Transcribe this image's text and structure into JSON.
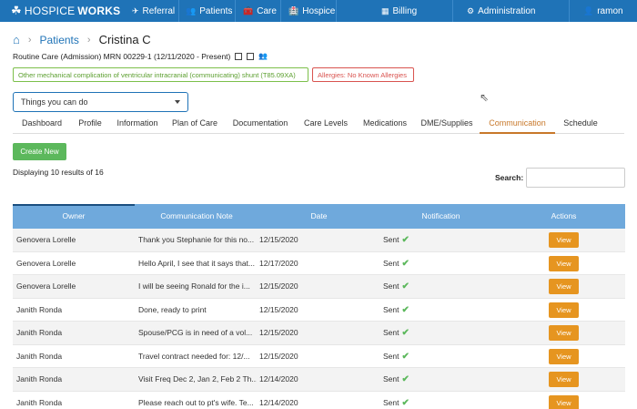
{
  "nav": {
    "brand_prefix": "HOSPICE",
    "brand_bold": "WORKS",
    "items": [
      {
        "label": "Referral",
        "icon": "✈"
      },
      {
        "label": "Patients",
        "icon": "👥"
      },
      {
        "label": "Care",
        "icon": "🧰"
      },
      {
        "label": "Hospice",
        "icon": "🏥"
      },
      {
        "label": "Billing",
        "icon": "▦"
      },
      {
        "label": "Administration",
        "icon": "⚙"
      },
      {
        "label": "ramon",
        "icon": "👤"
      }
    ]
  },
  "breadcrumb": {
    "home_icon": "⌂",
    "patients": "Patients",
    "current": "Cristina C"
  },
  "patient": {
    "care_line": "Routine Care (Admission) MRN 00229-1 (12/11/2020 - Present)",
    "diagnosis_tag": "Other mechanical complication of ventricular intracranial (communicating) shunt (T85.09XA)",
    "allergy_tag": "Allergies: No Known Allergies"
  },
  "actions_select": {
    "value": "Things you can do"
  },
  "tabs": [
    "Dashboard",
    "Profile",
    "Information",
    "Plan of Care",
    "Documentation",
    "Care Levels",
    "Medications",
    "DME/Supplies",
    "Communication",
    "Schedule"
  ],
  "active_tab": "Communication",
  "create_button": "Create New",
  "displaying": "Displaying 10 results of 16",
  "search_label": "Search:",
  "table": {
    "headers": [
      "Owner",
      "Communication Note",
      "Date",
      "Notification",
      "Actions"
    ],
    "rows": [
      {
        "owner": "Genovera Lorelle",
        "note": "Thank you Stephanie for this no...",
        "date": "12/15/2020",
        "notification": "Sent",
        "action": "View"
      },
      {
        "owner": "Genovera Lorelle",
        "note": "Hello April, I see that it says that...",
        "date": "12/17/2020",
        "notification": "Sent",
        "action": "View"
      },
      {
        "owner": "Genovera Lorelle",
        "note": "I will be seeing Ronald for the i...",
        "date": "12/15/2020",
        "notification": "Sent",
        "action": "View"
      },
      {
        "owner": "Janith Ronda",
        "note": "Done, ready to print",
        "date": "12/15/2020",
        "notification": "Sent",
        "action": "View"
      },
      {
        "owner": "Janith Ronda",
        "note": "Spouse/PCG is in need of a vol...",
        "date": "12/15/2020",
        "notification": "Sent",
        "action": "View"
      },
      {
        "owner": "Janith Ronda",
        "note": "Travel contract needed for: 12/...",
        "date": "12/15/2020",
        "notification": "Sent",
        "action": "View"
      },
      {
        "owner": "Janith Ronda",
        "note": "Visit Freq Dec 2, Jan 2, Feb 2 Th...",
        "date": "12/14/2020",
        "notification": "Sent",
        "action": "View"
      },
      {
        "owner": "Janith Ronda",
        "note": "Please reach out to pt's wife. Te...",
        "date": "12/14/2020",
        "notification": "Sent",
        "action": "View"
      }
    ]
  },
  "colors": {
    "nav_bg": "#1f73b7",
    "table_header": "#6fa9dc",
    "view_button": "#e69520",
    "create_button": "#5cb85c",
    "active_tab": "#c8782a"
  }
}
